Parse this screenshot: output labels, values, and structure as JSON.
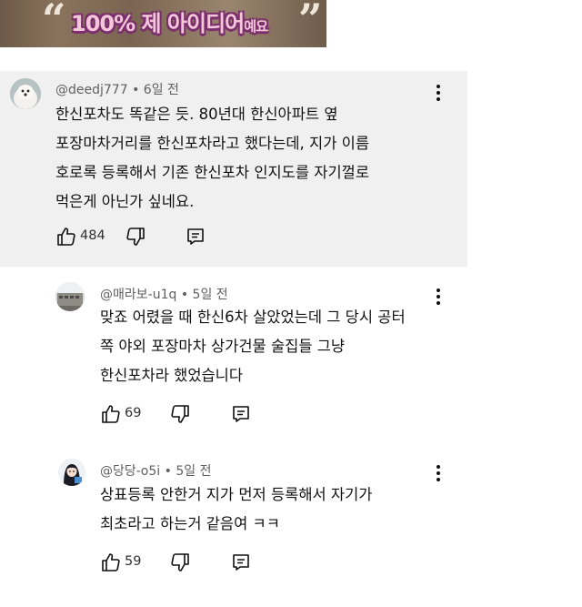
{
  "thumbnail": {
    "caption_main": "100% 제 아이디어",
    "caption_tail": "예요",
    "quote_open": "“",
    "quote_close": "”"
  },
  "comments": [
    {
      "author": "@deedj777",
      "time": "6일 전",
      "lines": [
        "한신포차도 똑같은 듯. 80년대 한신아파트 옆",
        "포장마차거리를 한신포차라고 했다는데, 지가 이름",
        "호로록 등록해서 기존 한신포차 인지도를 자기껄로",
        "먹은게 아닌가 싶네요."
      ],
      "likes": "484",
      "avatar_icon": "dog-avatar-icon"
    },
    {
      "author": "@매라보-u1q",
      "time": "5일 전",
      "lines": [
        "맞죠 어렸을 때 한신6차 살았었는데 그 당시 공터",
        "쪽 야외 포장마차 상가건물 술집들 그냥",
        "한신포차라 했었습니다"
      ],
      "likes": "69",
      "avatar_icon": "building-avatar-icon"
    },
    {
      "author": "@당당-o5i",
      "time": "5일 전",
      "lines": [
        "상표등록 안한거 지가 먼저 등록해서 자기가",
        "최초라고 하는거 같음여 ㅋㅋ"
      ],
      "likes": "59",
      "avatar_icon": "anime-girl-avatar-icon"
    }
  ],
  "meta_separator": "•",
  "colors": {
    "highlight_bg": "#f0f0f0",
    "meta_text": "#606060",
    "body_text": "#0f0f0f"
  }
}
